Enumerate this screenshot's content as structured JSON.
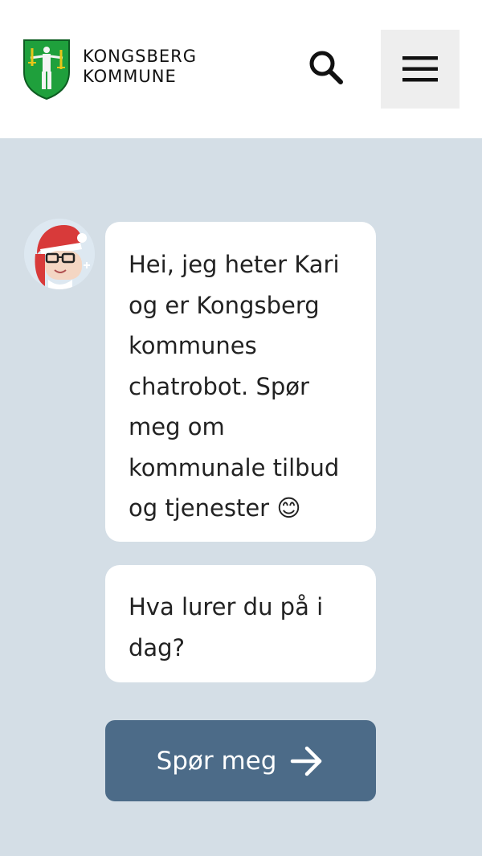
{
  "header": {
    "logo_line1": "KONGSBERG",
    "logo_line2": "KOMMUNE",
    "logo_icon": "coat-of-arms-icon",
    "search_icon": "search-icon",
    "menu_icon": "hamburger-menu-icon"
  },
  "chat": {
    "avatar_icon": "chatbot-avatar-icon",
    "messages": [
      "Hei, jeg heter Kari og er Kongsberg kommunes chatrobot. Spør meg om kommunale tilbud og tjenester 😊",
      "Hva lurer du på i dag?"
    ],
    "ask_button_label": "Spør meg",
    "ask_button_icon": "arrow-right-icon"
  },
  "colors": {
    "page_background": "#d4dee6",
    "header_background": "#ffffff",
    "bubble_background": "#ffffff",
    "button_background": "#4c6b88",
    "logo_green": "#1fa03c"
  }
}
